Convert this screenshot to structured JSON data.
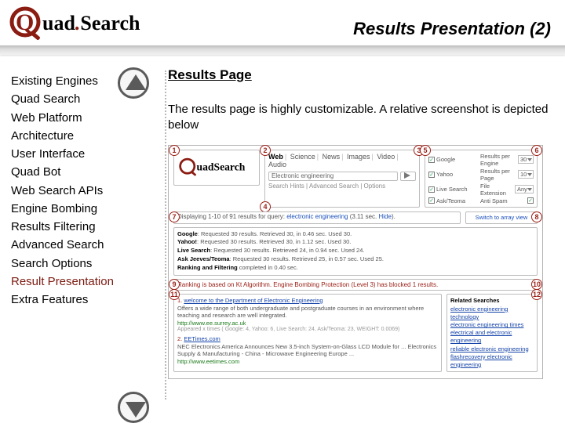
{
  "brand": {
    "word1": "uad",
    "word2": "Search",
    "initial": "Q"
  },
  "header": {
    "title": "Results Presentation (2)"
  },
  "nav": {
    "items": [
      "Existing Engines",
      "Quad Search",
      "Web Platform",
      "Architecture",
      "User Interface",
      "Quad Bot",
      "Web Search APIs",
      "Engine Bombing",
      "Results Filtering",
      "Advanced Search",
      "Search Options",
      "Result Presentation",
      "Extra Features"
    ],
    "current_index": 11
  },
  "main": {
    "section_heading": "Results Page",
    "intro": "The results page is highly customizable. A relative screenshot is depicted below"
  },
  "app": {
    "tabs": [
      "Web",
      "Science",
      "News",
      "Images",
      "Video",
      "Audio"
    ],
    "active_tab": "Web",
    "query": "Electronic engineering",
    "hints": "Search Hints | Advanced Search | Options",
    "engines_checks": [
      "Google",
      "Yahoo",
      "Live Search",
      "Ask/Teoma"
    ],
    "options": {
      "results_per_engine": {
        "label": "Results per Engine",
        "value": "30"
      },
      "results_per_page": {
        "label": "Results per Page",
        "value": "10"
      },
      "file_extension": {
        "label": "File Extension",
        "value": "Any"
      },
      "anti_spam": {
        "label": "Anti Spam",
        "checked": true
      }
    },
    "displaying": {
      "text_prefix": "Displaying 1-10 of 91 results for query:",
      "query": "electronic engineering",
      "time": "(3.11 sec.",
      "hide_label": "Hide",
      "time_suffix": ")."
    },
    "switch_label": "Switch to array view",
    "engine_lines": [
      {
        "name": "Google",
        "text": "Requested 30 results. Retrieved 30, in 0.46 sec. Used 30."
      },
      {
        "name": "Yahoo!",
        "text": "Requested 30 results. Retrieved 30, in 1.12 sec. Used 30."
      },
      {
        "name": "Live Search",
        "text": "Requested 30 results. Retrieved 24, in 0.94 sec. Used 24."
      },
      {
        "name": "Ask Jeeves/Teoma",
        "text": "Requested 30 results. Retrieved 25, in 0.57 sec. Used 25."
      },
      {
        "name": "Ranking and Filtering",
        "text": "completed in 0.40 sec."
      }
    ],
    "rank_bar": "Ranking is based on Kt Algorithm. Engine Bombing Protection (Level 3) has blocked 1 results.",
    "results": [
      {
        "num": "1.",
        "title": "welcome to the Department of Electronic Engineering",
        "desc": "Offers a wide range of both undergraduate and postgraduate courses in an environment where teaching and research are well integrated.",
        "url": "http://www.ee.surrey.ac.uk",
        "meta": "Appeared x times ( Google: 4, Yahoo: 6, Live Search: 24, Ask/Teoma: 23, WEIGHT: 0.0069)"
      },
      {
        "num": "2.",
        "title": "EETimes.com",
        "desc": "NEC Electronics America Announces New 3.5-inch System-on-Glass LCD Module for ... Electronics Supply & Manufacturing - China - Microwave Engineering Europe ...",
        "url": "http://www.eetimes.com",
        "meta": ""
      }
    ],
    "related": {
      "heading": "Related Searches",
      "items": [
        "electronic engineering technology",
        "electronic engineering times",
        "electrical and electronic engineering",
        "reliable electronic engineering",
        "flashrecovery electronic engineering"
      ]
    },
    "badges": {
      "b1": "1",
      "b2": "2",
      "b3": "3",
      "b4": "4",
      "b5": "5",
      "b6": "6",
      "b7": "7",
      "b8": "8",
      "b9": "9",
      "b10": "10",
      "b11": "11",
      "b12": "12"
    }
  }
}
